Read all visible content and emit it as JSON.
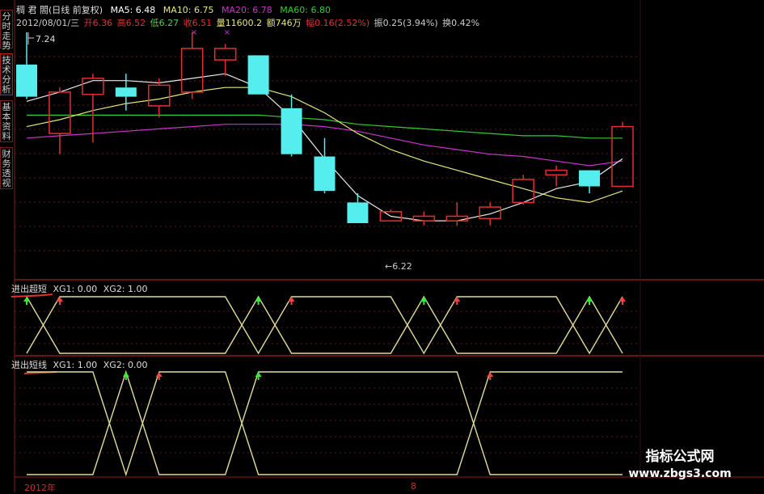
{
  "sidebar": {
    "tabs": [
      {
        "label": "分时走势",
        "active": false
      },
      {
        "label": "技术分析",
        "active": true
      },
      {
        "label": "基本资料",
        "active": false
      },
      {
        "label": "财务透视",
        "active": false
      }
    ]
  },
  "header": {
    "line1": {
      "title": "稠 君 閤(日线 前复权)",
      "ma5": "MA5: 6.48",
      "ma10": "MA10: 6.75",
      "ma20": "MA20: 6.78",
      "ma60": "MA60: 6.80"
    },
    "line2": {
      "date": "2012/08/01/三",
      "open": "开6.36",
      "high": "高6.52",
      "low": "低6.27",
      "close": "收6.51",
      "volume": "量11600.2",
      "amount": "额746万",
      "change": "幅0.16(2.52%)",
      "amplitude": "振0.25(3.94%)",
      "turnover": "换0.42%"
    }
  },
  "colors": {
    "up": "#e03030",
    "down": "#55eeee",
    "ma5": "#e8e8e8",
    "ma10": "#e6e67a",
    "ma20": "#cc33cc",
    "ma60": "#33cc33",
    "signal_line": "#e0dc9a",
    "pane_border": "#8a1a1a",
    "grid": "#5a1a1a",
    "buy_arrow": "#33ee33",
    "sell_arrow": "#ee4444"
  },
  "annotations": {
    "high_label": "7.24",
    "low_label": "6.22"
  },
  "indicator1": {
    "title": "进出超短",
    "xg1": "XG1: 0.00",
    "xg2": "XG2: 1.00"
  },
  "indicator2": {
    "title": "进出短线",
    "xg1": "XG1: 1.00",
    "xg2": "XG2: 0.00"
  },
  "footer": {
    "year": "2012年",
    "month": "8"
  },
  "logo": {
    "line1": "指标公式网",
    "line2": "www.zbgs3.com"
  },
  "chart_data": {
    "type": "candlestick",
    "candles": [
      {
        "o": 7.1,
        "h": 7.24,
        "l": 6.95,
        "c": 6.96,
        "up": false
      },
      {
        "o": 6.8,
        "h": 7.0,
        "l": 6.71,
        "c": 6.98,
        "up": true
      },
      {
        "o": 6.97,
        "h": 7.06,
        "l": 6.76,
        "c": 7.04,
        "up": true
      },
      {
        "o": 7.0,
        "h": 7.06,
        "l": 6.9,
        "c": 6.96,
        "up": false
      },
      {
        "o": 6.92,
        "h": 7.04,
        "l": 6.87,
        "c": 7.01,
        "up": true
      },
      {
        "o": 6.98,
        "h": 7.24,
        "l": 6.95,
        "c": 7.17,
        "up": true
      },
      {
        "o": 7.12,
        "h": 7.19,
        "l": 7.05,
        "c": 7.17,
        "up": true
      },
      {
        "o": 7.14,
        "h": 7.14,
        "l": 6.97,
        "c": 6.97,
        "up": false
      },
      {
        "o": 6.91,
        "h": 6.97,
        "l": 6.7,
        "c": 6.71,
        "up": false
      },
      {
        "o": 6.7,
        "h": 6.78,
        "l": 6.54,
        "c": 6.55,
        "up": false
      },
      {
        "o": 6.5,
        "h": 6.54,
        "l": 6.41,
        "c": 6.41,
        "up": false
      },
      {
        "o": 6.42,
        "h": 6.47,
        "l": 6.42,
        "c": 6.46,
        "up": true
      },
      {
        "o": 6.42,
        "h": 6.46,
        "l": 6.4,
        "c": 6.44,
        "up": true
      },
      {
        "o": 6.42,
        "h": 6.5,
        "l": 6.4,
        "c": 6.44,
        "up": true
      },
      {
        "o": 6.43,
        "h": 6.5,
        "l": 6.4,
        "c": 6.48,
        "up": true
      },
      {
        "o": 6.5,
        "h": 6.62,
        "l": 6.49,
        "c": 6.6,
        "up": true
      },
      {
        "o": 6.62,
        "h": 6.66,
        "l": 6.57,
        "c": 6.64,
        "up": true
      },
      {
        "o": 6.64,
        "h": 6.64,
        "l": 6.54,
        "c": 6.57,
        "up": false
      },
      {
        "o": 6.57,
        "h": 6.85,
        "l": 6.57,
        "c": 6.83,
        "up": true
      }
    ],
    "ma5": [
      6.94,
      6.98,
      7.03,
      7.03,
      7.02,
      7.04,
      7.06,
      7.0,
      6.87,
      6.69,
      6.53,
      6.44,
      6.42,
      6.42,
      6.45,
      6.5,
      6.56,
      6.59,
      6.69
    ],
    "ma10": [
      6.83,
      6.86,
      6.9,
      6.93,
      6.95,
      6.98,
      7.0,
      7.0,
      6.96,
      6.89,
      6.8,
      6.73,
      6.68,
      6.64,
      6.6,
      6.56,
      6.52,
      6.5,
      6.55
    ],
    "ma20": [
      6.78,
      6.79,
      6.8,
      6.81,
      6.82,
      6.83,
      6.84,
      6.84,
      6.84,
      6.83,
      6.81,
      6.78,
      6.75,
      6.73,
      6.71,
      6.7,
      6.68,
      6.66,
      6.68
    ],
    "ma60": [
      6.88,
      6.88,
      6.88,
      6.88,
      6.88,
      6.88,
      6.88,
      6.88,
      6.87,
      6.86,
      6.84,
      6.83,
      6.82,
      6.81,
      6.8,
      6.79,
      6.79,
      6.78,
      6.78
    ],
    "ylim": [
      6.22,
      7.24
    ],
    "indicator1": {
      "xg1": [
        1,
        0,
        0,
        0,
        0,
        0,
        0,
        1,
        0,
        0,
        0,
        0,
        1,
        0,
        0,
        0,
        0,
        1,
        0
      ],
      "xg2": [
        0,
        1,
        1,
        1,
        1,
        1,
        1,
        0,
        1,
        1,
        1,
        1,
        0,
        1,
        1,
        1,
        1,
        0,
        1
      ]
    },
    "indicator2": {
      "xg1": [
        0,
        0,
        0,
        1,
        0,
        0,
        0,
        1,
        1,
        1,
        1,
        1,
        1,
        1,
        0,
        0,
        0,
        0,
        0
      ],
      "xg2": [
        1,
        1,
        1,
        0,
        1,
        1,
        1,
        0,
        0,
        0,
        0,
        0,
        0,
        0,
        1,
        1,
        1,
        1,
        1
      ]
    }
  }
}
